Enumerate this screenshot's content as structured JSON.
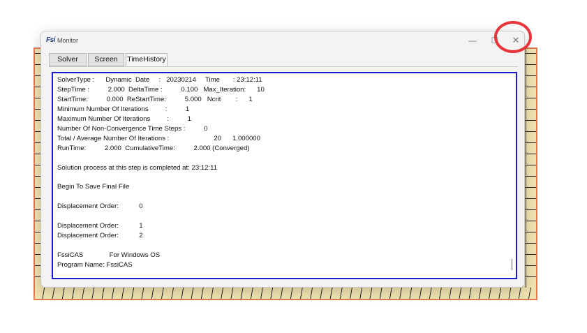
{
  "window": {
    "app_icon": "Fsi",
    "title": "Monitor",
    "controls": {
      "minimize": "—",
      "maximize": "☐",
      "close": "✕"
    }
  },
  "tabs": [
    {
      "label": "Solver"
    },
    {
      "label": "Screen"
    },
    {
      "label": "TimeHistory"
    }
  ],
  "log_lines": [
    "SolverType :      Dynamic  Date     :   20230214     Time       : 23:12:11",
    "StepTime :          2.000  DeltaTime :          0.100   Max_Iteration:      10",
    "StartTime:          0.000  ReStartTime:          5.000   Ncrit        :      1",
    "Minimum Number Of Iterations         :          1",
    "Maximum Number Of Iterations         :          1",
    "Number Of Non-Convergence Time Steps :          0",
    "Total / Average Number Of Iterations :                        20      1.000000",
    "RunTime:          2.000  CumulativeTime:          2.000 (Converged)",
    "Solution process at this step is completed at: 23:12:11",
    "Begin To Save Final File",
    "Displacement Order:           0",
    "Displacement Order:           1",
    "Displacement Order:           2",
    "FssiCAS              For Windows OS",
    "Program Name: FssiCAS"
  ]
}
